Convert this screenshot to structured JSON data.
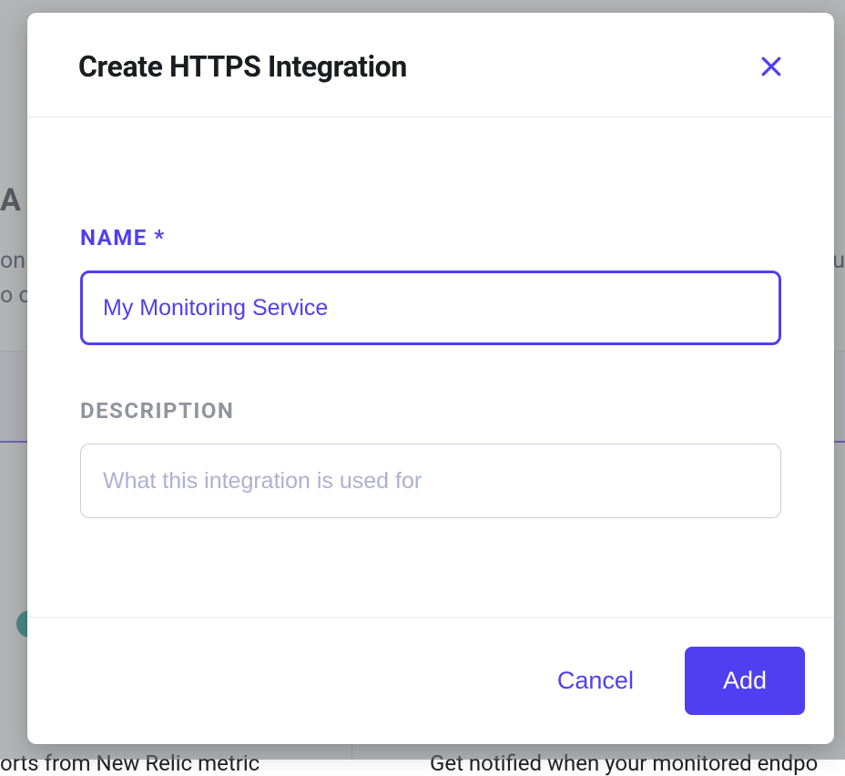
{
  "background": {
    "heading_fragment": "A",
    "paragraph_fragment_line1": "on",
    "paragraph_fragment_line2": "o c",
    "paragraph_right_fragment": "ou",
    "footer_left_fragment": "orts from New Relic metric",
    "footer_right_fragment": "Get notified when your monitored endpo"
  },
  "modal": {
    "title": "Create HTTPS Integration",
    "fields": {
      "name": {
        "label": "NAME *",
        "value": "My Monitoring Service"
      },
      "description": {
        "label": "DESCRIPTION",
        "value": "",
        "placeholder": "What this integration is used for"
      }
    },
    "buttons": {
      "cancel_label": "Cancel",
      "add_label": "Add"
    }
  }
}
